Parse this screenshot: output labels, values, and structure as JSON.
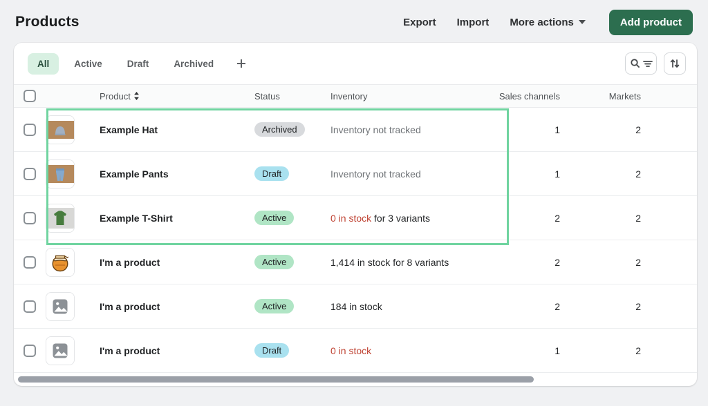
{
  "page": {
    "title": "Products"
  },
  "header": {
    "export_label": "Export",
    "import_label": "Import",
    "more_actions_label": "More actions",
    "add_product_label": "Add product"
  },
  "tabs": {
    "items": [
      {
        "label": "All",
        "selected": true
      },
      {
        "label": "Active",
        "selected": false
      },
      {
        "label": "Draft",
        "selected": false
      },
      {
        "label": "Archived",
        "selected": false
      }
    ]
  },
  "toolbar": {
    "search_filter_icon": "search-and-filter-icon",
    "sort_icon": "sort-arrows-icon"
  },
  "table": {
    "columns": {
      "product": "Product",
      "status": "Status",
      "inventory": "Inventory",
      "sales_channels": "Sales channels",
      "markets": "Markets"
    },
    "rows": [
      {
        "name": "Example Hat",
        "status": "Archived",
        "inventory_alert": "",
        "inventory_text": "Inventory not tracked",
        "sales_channels": "1",
        "markets": "2",
        "image": "hat-photo"
      },
      {
        "name": "Example Pants",
        "status": "Draft",
        "inventory_alert": "",
        "inventory_text": "Inventory not tracked",
        "sales_channels": "1",
        "markets": "2",
        "image": "pants-photo"
      },
      {
        "name": "Example T-Shirt",
        "status": "Active",
        "inventory_alert": "0 in stock",
        "inventory_text": " for 3 variants",
        "sales_channels": "2",
        "markets": "2",
        "image": "tshirt-photo"
      },
      {
        "name": "I'm a product",
        "status": "Active",
        "inventory_alert": "",
        "inventory_text": "1,414 in stock for 8 variants",
        "sales_channels": "2",
        "markets": "2",
        "image": "honey-jar-photo"
      },
      {
        "name": "I'm a product",
        "status": "Active",
        "inventory_alert": "",
        "inventory_text": "184 in stock",
        "sales_channels": "2",
        "markets": "2",
        "image": "placeholder-image"
      },
      {
        "name": "I'm a product",
        "status": "Draft",
        "inventory_alert": "0 in stock",
        "inventory_text": "",
        "sales_channels": "1",
        "markets": "2",
        "image": "placeholder-image"
      }
    ]
  },
  "colors": {
    "accent_green_button": "#2c6e4f",
    "selected_tab_bg": "#d8f0e2",
    "badge_active_bg": "#b0e5c5",
    "badge_draft_bg": "#a9e1ef",
    "badge_archived_bg": "#d8dadd",
    "alert_text": "#bf4232",
    "highlight_border": "#70d4a0"
  }
}
